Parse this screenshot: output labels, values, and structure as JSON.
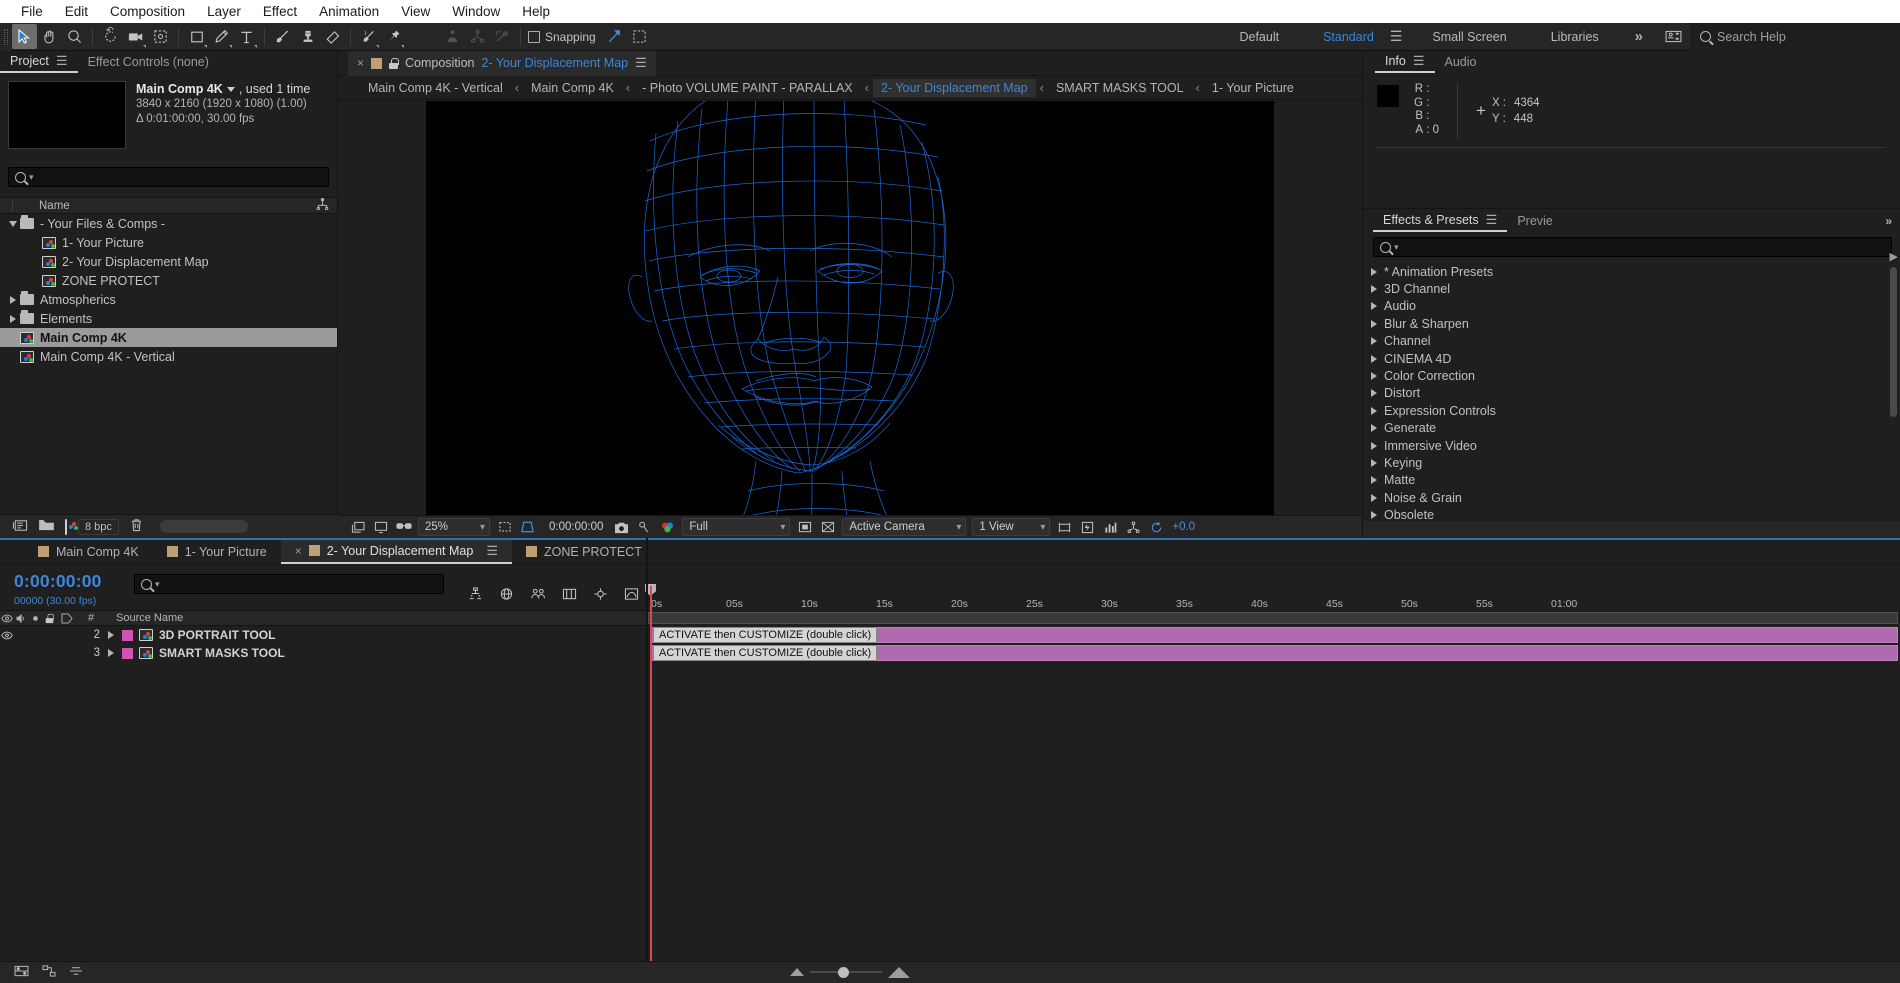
{
  "menu": {
    "items": [
      "File",
      "Edit",
      "Composition",
      "Layer",
      "Effect",
      "Animation",
      "View",
      "Window",
      "Help"
    ]
  },
  "toolbar": {
    "tools": [
      {
        "name": "selection-tool",
        "glyph": "arrow",
        "selected": true
      },
      {
        "name": "hand-tool",
        "glyph": "hand",
        "selected": false
      },
      {
        "name": "zoom-tool",
        "glyph": "magnifier",
        "selected": false
      },
      {
        "name": "rotation-tool",
        "glyph": "rotate",
        "selected": false
      },
      {
        "name": "camera-tool",
        "glyph": "camera",
        "selected": false
      },
      {
        "name": "pan-behind-tool",
        "glyph": "anchor",
        "selected": false
      },
      {
        "name": "shape-tool",
        "glyph": "rect",
        "selected": false
      },
      {
        "name": "pen-tool",
        "glyph": "pen",
        "selected": false
      },
      {
        "name": "type-tool",
        "glyph": "type",
        "selected": false
      },
      {
        "name": "brush-tool",
        "glyph": "brush",
        "selected": false
      },
      {
        "name": "clone-stamp-tool",
        "glyph": "stamp",
        "selected": false
      },
      {
        "name": "eraser-tool",
        "glyph": "eraser",
        "selected": false
      },
      {
        "name": "roto-brush-tool",
        "glyph": "roto",
        "selected": false
      },
      {
        "name": "puppet-pin-tool",
        "glyph": "pin",
        "selected": false
      }
    ],
    "snapping_label": "Snapping",
    "workspaces": [
      "Default",
      "Standard",
      "Small Screen",
      "Libraries"
    ],
    "active_workspace": "Standard",
    "chevron": "»",
    "search_help_placeholder": "Search Help"
  },
  "project": {
    "tabs": [
      {
        "label": "Project",
        "active": true,
        "has_menu": true
      },
      {
        "label": "Effect Controls  (none)",
        "active": false,
        "has_menu": false
      }
    ],
    "selected_item_name": "Main Comp 4K",
    "selected_item_usage": ", used 1 time",
    "selected_item_dimensions": "3840 x 2160  (1920 x 1080) (1.00)",
    "selected_item_duration": "Δ 0:01:00:00, 30.00 fps",
    "column_header": "Name",
    "items": [
      {
        "label": "- Your Files & Comps -",
        "type": "folder",
        "expanded": true,
        "depth": 0,
        "selected": false
      },
      {
        "label": "1- Your Picture",
        "type": "comp",
        "depth": 1,
        "selected": false
      },
      {
        "label": "2- Your Displacement Map",
        "type": "comp",
        "depth": 1,
        "selected": false
      },
      {
        "label": "ZONE PROTECT",
        "type": "comp",
        "depth": 1,
        "selected": false
      },
      {
        "label": "Atmospherics",
        "type": "folder",
        "expanded": false,
        "depth": 0,
        "selected": false
      },
      {
        "label": "Elements",
        "type": "folder",
        "expanded": false,
        "depth": 0,
        "selected": false
      },
      {
        "label": "Main Comp 4K",
        "type": "comp",
        "depth": 0,
        "selected": true
      },
      {
        "label": "Main Comp 4K - Vertical",
        "type": "comp",
        "depth": 0,
        "selected": false
      }
    ],
    "footer": {
      "bpc": "8 bpc"
    }
  },
  "composition": {
    "tab_prefix": "Composition",
    "tab_name": "2- Your Displacement Map",
    "close_glyph": "×",
    "breadcrumbs": [
      {
        "label": "Main Comp 4K - Vertical",
        "current": false
      },
      {
        "label": "Main Comp 4K",
        "current": false
      },
      {
        "label": "- Photo VOLUME PAINT - PARALLAX",
        "current": false
      },
      {
        "label": "2- Your Displacement Map",
        "current": true
      },
      {
        "label": "SMART MASKS TOOL",
        "current": false
      },
      {
        "label": "1- Your Picture",
        "current": false
      }
    ],
    "breadcrumb_separator": "‹",
    "footer": {
      "zoom": "25%",
      "timecode": "0:00:00:00",
      "resolution": "Full",
      "camera": "Active Camera",
      "views": "1 View",
      "exposure": "+0.0"
    },
    "wireframe_color": "#1f6fe8",
    "canvas_background": "#000000"
  },
  "info": {
    "tabs": [
      {
        "label": "Info",
        "active": true,
        "has_menu": true
      },
      {
        "label": "Audio",
        "active": false,
        "has_menu": false
      }
    ],
    "channels": [
      {
        "key": "R",
        "value": ""
      },
      {
        "key": "G",
        "value": ""
      },
      {
        "key": "B",
        "value": ""
      },
      {
        "key": "A",
        "value": "0"
      }
    ],
    "x_label": "X :",
    "x_value": "4364",
    "y_label": "Y :",
    "y_value": "448"
  },
  "effects_presets": {
    "tabs": [
      {
        "label": "Effects & Presets",
        "active": true,
        "has_menu": true
      },
      {
        "label": "Previe",
        "active": false,
        "has_menu": false
      }
    ],
    "categories": [
      "* Animation Presets",
      "3D Channel",
      "Audio",
      "Blur & Sharpen",
      "Channel",
      "CINEMA 4D",
      "Color Correction",
      "Distort",
      "Expression Controls",
      "Generate",
      "Immersive Video",
      "Keying",
      "Matte",
      "Noise & Grain",
      "Obsolete"
    ]
  },
  "timeline": {
    "tabs": [
      {
        "label": "Main Comp 4K",
        "active": false,
        "closable": false
      },
      {
        "label": "1- Your Picture",
        "active": false,
        "closable": false
      },
      {
        "label": "2- Your Displacement Map",
        "active": true,
        "closable": true
      },
      {
        "label": "ZONE PROTECT",
        "active": false,
        "closable": false
      }
    ],
    "current_time": "0:00:00:00",
    "frame_label": "00000 (30.00 fps)",
    "column_headers": [
      "#",
      "Source Name"
    ],
    "ruler_ticks": [
      "0s",
      "05s",
      "10s",
      "15s",
      "20s",
      "25s",
      "30s",
      "35s",
      "40s",
      "45s",
      "50s",
      "55s",
      "01:00"
    ],
    "layers": [
      {
        "index": "2",
        "name": "3D PORTRAIT TOOL",
        "color": "#d153b0",
        "bar_label": "ACTIVATE then CUSTOMIZE (double click)",
        "visible": true
      },
      {
        "index": "3",
        "name": "SMART MASKS TOOL",
        "color": "#d153b0",
        "bar_label": "ACTIVATE then CUSTOMIZE (double click)",
        "visible": false
      }
    ]
  },
  "colors": {
    "accent_blue": "#3f86d6",
    "panel_bg": "#1f1f1f",
    "toolbar_bg": "#262626",
    "layer_magenta": "#b06ab0",
    "playhead_red": "#d94a4a"
  }
}
